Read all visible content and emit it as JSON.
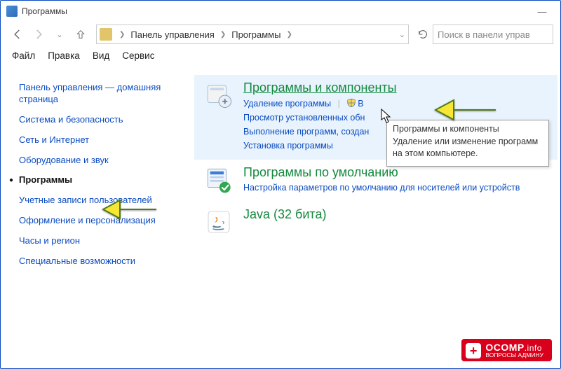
{
  "window": {
    "title": "Программы",
    "minimize": "—",
    "close": "×"
  },
  "nav": {
    "breadcrumb": {
      "seg1": "Панель управления",
      "seg2": "Программы"
    },
    "search_placeholder": "Поиск в панели управ"
  },
  "menu": {
    "file": "Файл",
    "edit": "Правка",
    "view": "Вид",
    "service": "Сервис"
  },
  "sidebar": {
    "items": [
      "Панель управления — домашняя страница",
      "Система и безопасность",
      "Сеть и Интернет",
      "Оборудование и звук",
      "Программы",
      "Учетные записи пользователей",
      "Оформление и персонализация",
      "Часы и регион",
      "Специальные возможности"
    ],
    "active_index": 4
  },
  "main": {
    "cat0": {
      "title": "Программы и компоненты",
      "links": {
        "l0": "Удаление программы",
        "l1": "В",
        "l2": "Просмотр установленных обн",
        "l3": "Выполнение программ, создан",
        "l4": "Установка программы"
      }
    },
    "cat1": {
      "title": "Программы по умолчанию",
      "desc": "Настройка параметров по умолчанию для носителей или устройств"
    },
    "cat2": {
      "title": "Java (32 бита)"
    }
  },
  "tooltip": {
    "title": "Программы и компоненты",
    "body": "Удаление или изменение программ на этом компьютере."
  },
  "watermark": {
    "brand": "OCOMP",
    "tld": ".info",
    "subtitle": "ВОПРОСЫ АДМИНУ"
  }
}
